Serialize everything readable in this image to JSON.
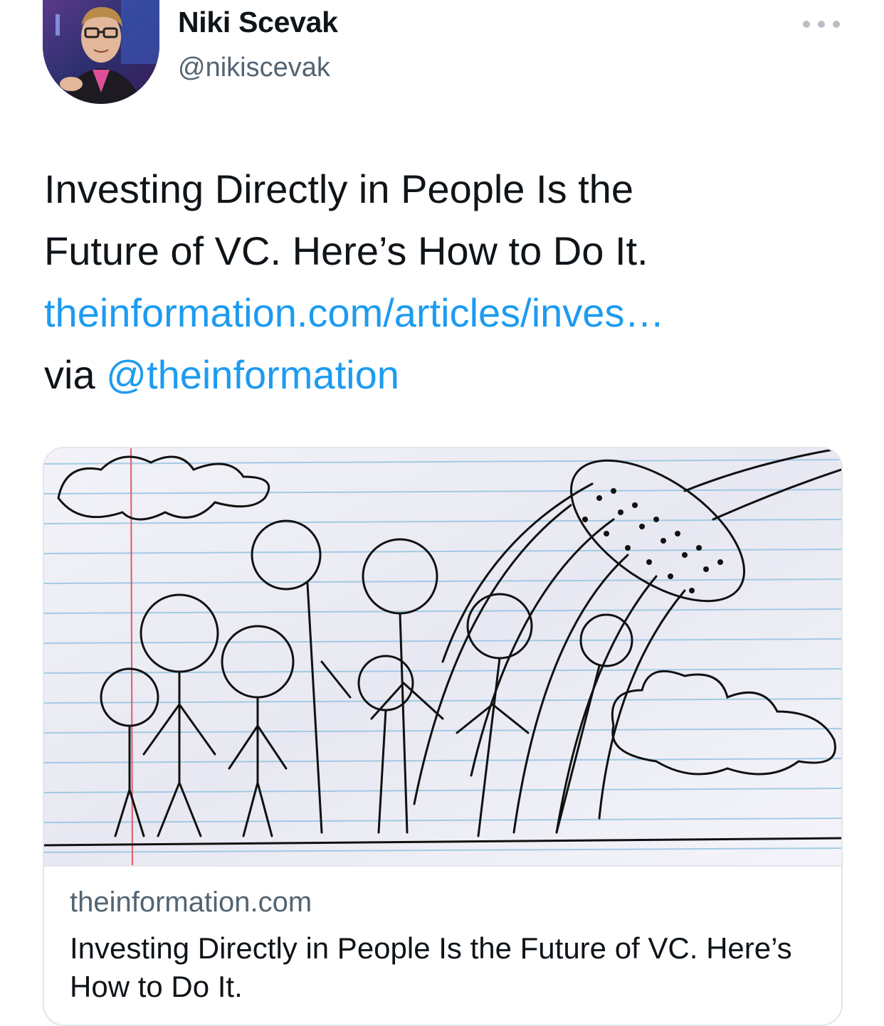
{
  "user": {
    "name": "Niki Scevak",
    "handle": "@nikiscevak"
  },
  "tweet": {
    "line1": "Investing Directly in People Is the",
    "line2": "Future of VC. Here’s How to Do It.",
    "link": "theinformation.com/articles/inves…",
    "via": "via ",
    "mention": "@theinformation"
  },
  "card": {
    "domain": "theinformation.com",
    "title": "Investing Directly in People Is the Future of VC. Here’s How to Do It."
  },
  "icons": {
    "more": "more-options-icon"
  },
  "colors": {
    "link": "#1d9bf0",
    "secondary_text": "#536471",
    "primary_text": "#0f1419"
  }
}
